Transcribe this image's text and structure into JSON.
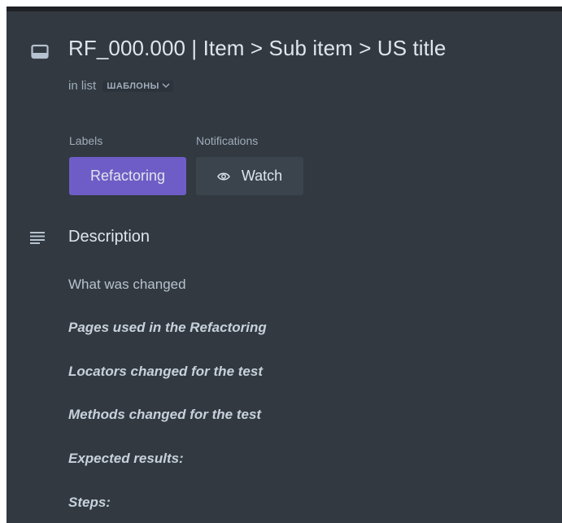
{
  "card": {
    "title": "RF_000.000 | Item > Sub item > US title",
    "in_list_prefix": "in list",
    "list_name": "ШАБЛОНЫ",
    "icon": "card-icon"
  },
  "labels": {
    "heading": "Labels",
    "items": [
      "Refactoring"
    ],
    "colors": {
      "refactoring": "#6e5dc6"
    }
  },
  "notifications": {
    "heading": "Notifications",
    "watch_label": "Watch",
    "icon": "eye-icon"
  },
  "description": {
    "heading": "Description",
    "icon": "description-icon",
    "lines": [
      "What was changed",
      "Pages used in the Refactoring",
      "Locators changed for the test",
      "Methods changed for the test",
      "Expected results:",
      "Steps:"
    ]
  },
  "theme": {
    "background": "#323940",
    "text": "#b6c2cf",
    "accent": "#6e5dc6"
  }
}
